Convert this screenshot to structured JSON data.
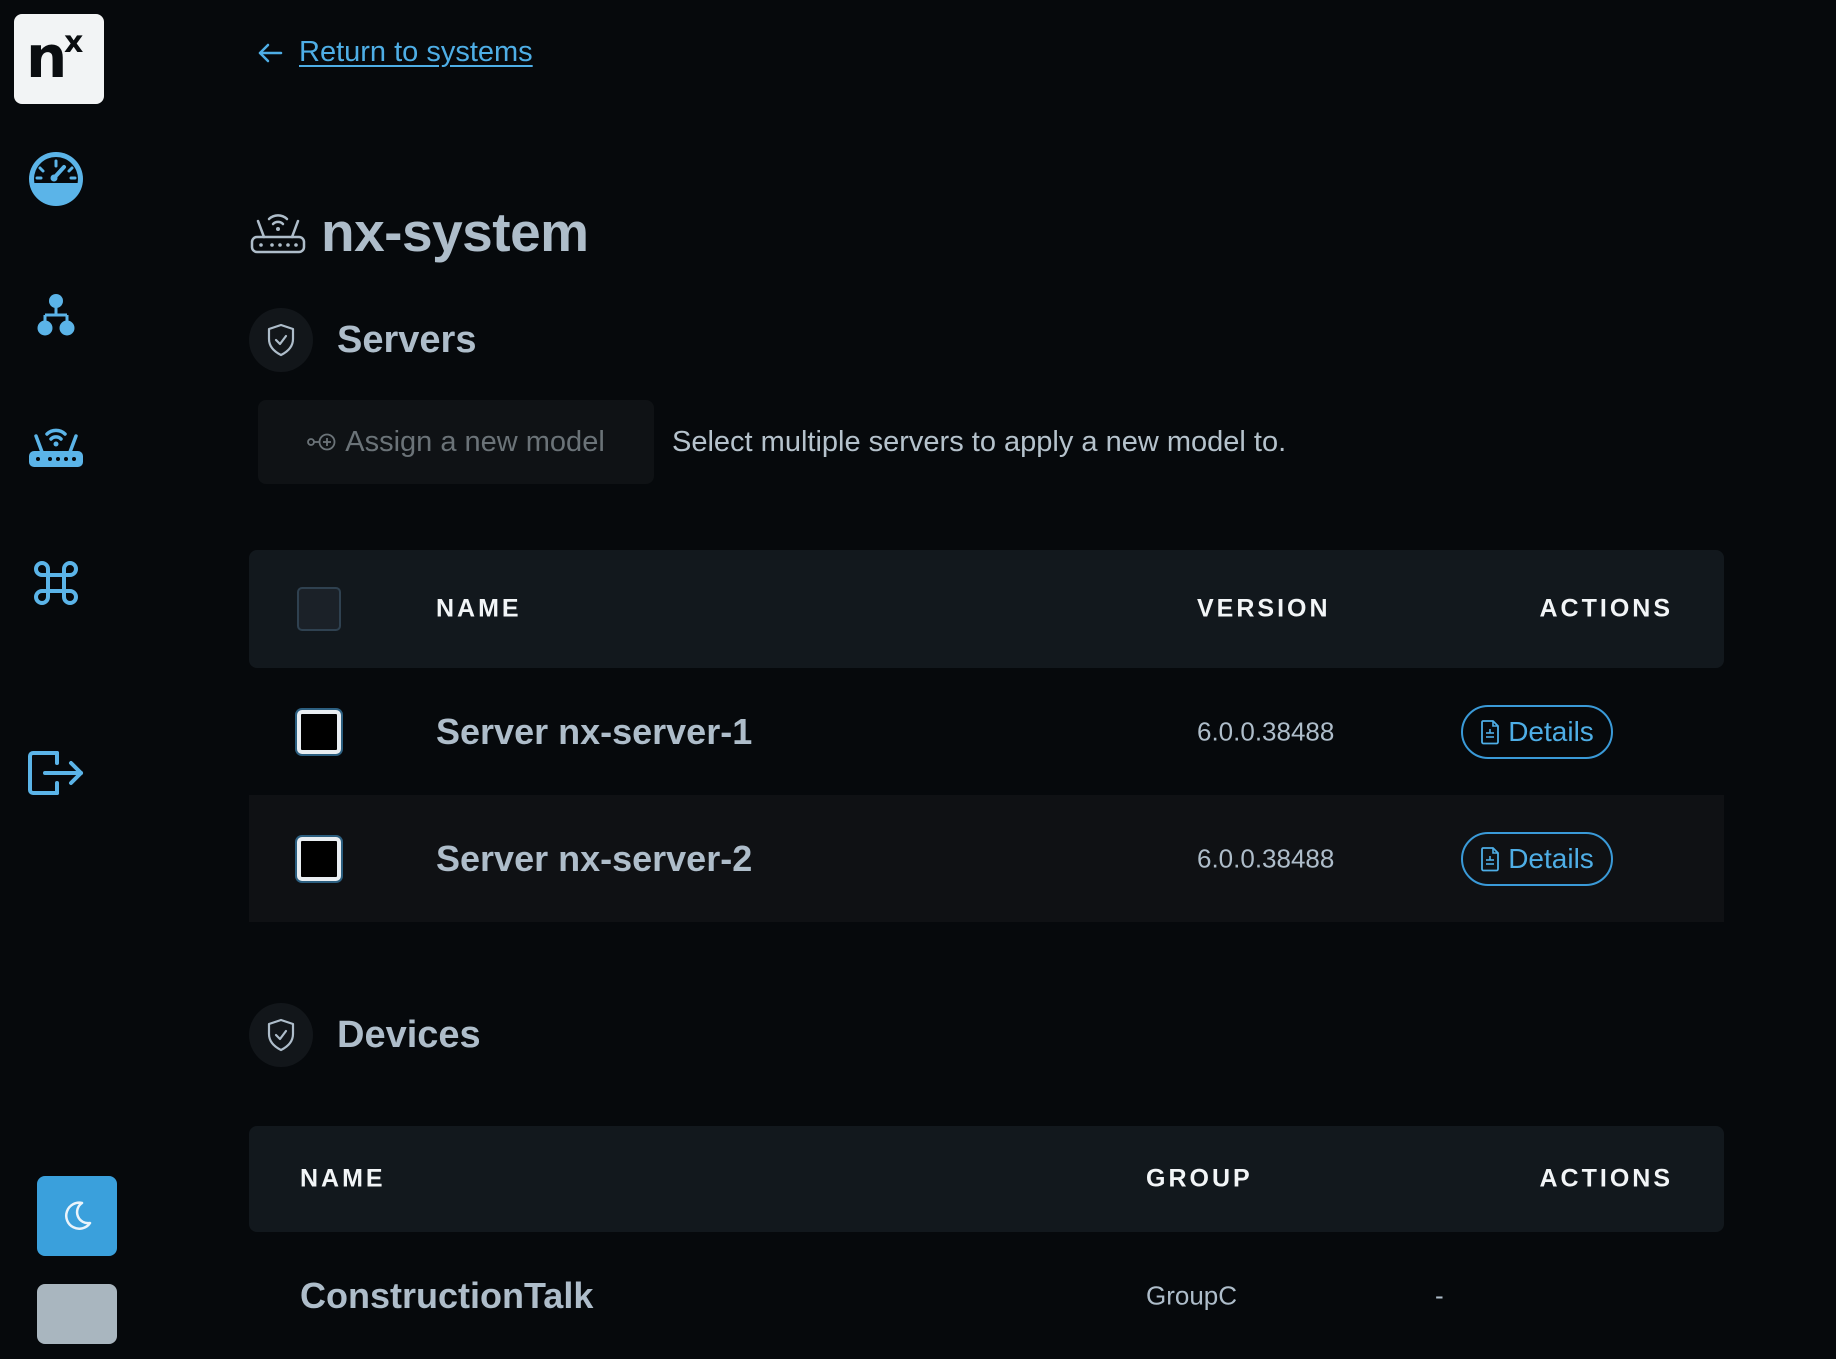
{
  "sidebar": {
    "logo": {
      "main": "n",
      "sup": "x"
    },
    "items": [
      {
        "name": "dashboard",
        "icon": "gauge-icon"
      },
      {
        "name": "organization",
        "icon": "hierarchy-icon"
      },
      {
        "name": "systems",
        "icon": "router-icon"
      },
      {
        "name": "commands",
        "icon": "command-icon"
      },
      {
        "name": "logout",
        "icon": "logout-icon"
      }
    ],
    "theme_toggle_icon": "moon-icon"
  },
  "back_link": {
    "label": "Return to systems",
    "icon": "arrow-left-icon"
  },
  "page": {
    "title": "nx-system",
    "icon": "router-icon"
  },
  "servers": {
    "heading": "Servers",
    "icon": "shield-check-icon",
    "assign_button": {
      "label": "Assign a new model",
      "icon": "assign-icon"
    },
    "assign_hint": "Select multiple servers to apply a new model to.",
    "columns": {
      "name": "NAME",
      "version": "VERSION",
      "actions": "ACTIONS"
    },
    "rows": [
      {
        "name": "Server nx-server-1",
        "version": "6.0.0.38488",
        "action": "Details"
      },
      {
        "name": "Server nx-server-2",
        "version": "6.0.0.38488",
        "action": "Details"
      }
    ]
  },
  "devices": {
    "heading": "Devices",
    "icon": "shield-check-icon",
    "columns": {
      "name": "NAME",
      "group": "GROUP",
      "actions": "ACTIONS"
    },
    "rows": [
      {
        "name": "ConstructionTalk",
        "group": "GroupC",
        "action": "-"
      }
    ]
  },
  "colors": {
    "background": "#06090c",
    "accent": "#3aa0dc",
    "link": "#4eaee6",
    "heading": "#aebdca",
    "table_header": "#12181d"
  }
}
